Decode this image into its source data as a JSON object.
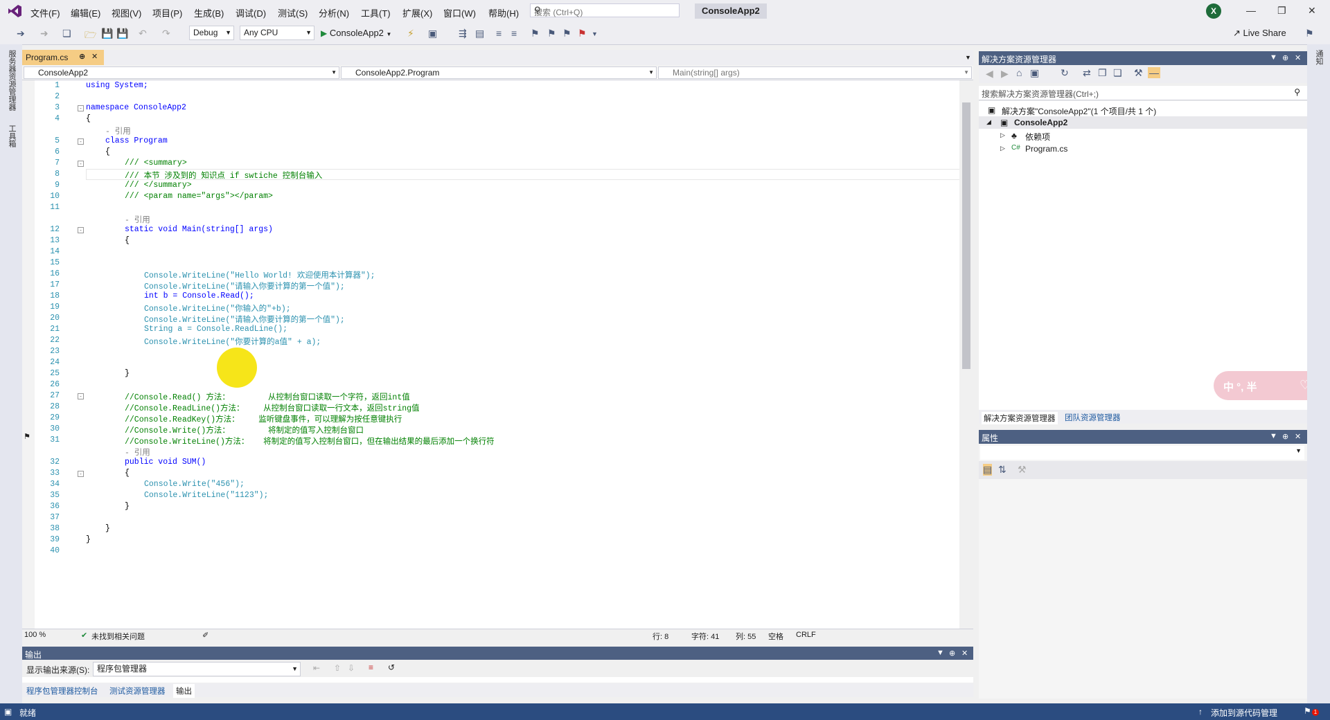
{
  "menubar": {
    "items": [
      "文件(F)",
      "编辑(E)",
      "视图(V)",
      "项目(P)",
      "生成(B)",
      "调试(D)",
      "测试(S)",
      "分析(N)",
      "工具(T)",
      "扩展(X)",
      "窗口(W)",
      "帮助(H)"
    ],
    "search_placeholder": "搜索 (Ctrl+Q)",
    "app_title": "ConsoleApp2",
    "profile_initial": "X"
  },
  "toolbar": {
    "config": "Debug",
    "platform": "Any CPU",
    "run_target": "ConsoleApp2",
    "live_share": "Live Share"
  },
  "left_strip": {
    "server_explorer": "服务器资源管理器",
    "toolbox": "工具箱"
  },
  "right_strip": {
    "notifications": "通知"
  },
  "editor": {
    "tab_label": "Program.cs",
    "nav_project": "ConsoleApp2",
    "nav_class": "ConsoleApp2.Program",
    "nav_member": "Main(string[] args)",
    "zoom": "100 %",
    "issues": "未找到相关问题",
    "line": "行: 8",
    "char": "字符: 41",
    "col": "列: 55",
    "whitespace": "空格",
    "eol": "CRLF",
    "lines": [
      {
        "n": "1",
        "t": "using System;"
      },
      {
        "n": "2",
        "t": ""
      },
      {
        "n": "3",
        "t": "namespace ConsoleApp2"
      },
      {
        "n": "4",
        "t": "{"
      },
      {
        "n": "",
        "t": "- 引用"
      },
      {
        "n": "5",
        "t": "class Program"
      },
      {
        "n": "6",
        "t": "{"
      },
      {
        "n": "7",
        "t": "/// <summary>"
      },
      {
        "n": "8",
        "t": "/// 本节 涉及到的 知识点 if swtiche 控制台输入"
      },
      {
        "n": "9",
        "t": "/// </summary>"
      },
      {
        "n": "10",
        "t": "/// <param name=\"args\"></param>"
      },
      {
        "n": "11",
        "t": ""
      },
      {
        "n": "",
        "t": "- 引用"
      },
      {
        "n": "12",
        "t": "static void Main(string[] args)"
      },
      {
        "n": "13",
        "t": "{"
      },
      {
        "n": "14",
        "t": ""
      },
      {
        "n": "15",
        "t": ""
      },
      {
        "n": "16",
        "t": "Console.WriteLine(\"Hello World! 欢迎使用本计算器\");"
      },
      {
        "n": "17",
        "t": "Console.WriteLine(\"请输入你要计算的第一个值\");"
      },
      {
        "n": "18",
        "t": "int b = Console.Read();"
      },
      {
        "n": "19",
        "t": "Console.WriteLine(\"你输入的\"+b);"
      },
      {
        "n": "20",
        "t": "Console.WriteLine(\"请输入你要计算的第一个值\");"
      },
      {
        "n": "21",
        "t": "String a = Console.ReadLine();"
      },
      {
        "n": "22",
        "t": "Console.WriteLine(\"你要计算的a值\" + a);"
      },
      {
        "n": "23",
        "t": ""
      },
      {
        "n": "24",
        "t": ""
      },
      {
        "n": "25",
        "t": "}"
      },
      {
        "n": "26",
        "t": ""
      },
      {
        "n": "27",
        "t": "//Console.Read() 方法：        从控制台窗口读取一个字符，返回int值"
      },
      {
        "n": "28",
        "t": "//Console.ReadLine()方法：    从控制台窗口读取一行文本，返回string值"
      },
      {
        "n": "29",
        "t": "//Console.ReadKey()方法：    监听键盘事件，可以理解为按任意键执行"
      },
      {
        "n": "30",
        "t": "//Console.Write()方法：        将制定的值写入控制台窗口"
      },
      {
        "n": "31",
        "t": "//Console.WriteLine()方法：   将制定的值写入控制台窗口，但在输出结果的最后添加一个换行符"
      },
      {
        "n": "",
        "t": "- 引用"
      },
      {
        "n": "32",
        "t": "public void SUM()"
      },
      {
        "n": "33",
        "t": "{"
      },
      {
        "n": "34",
        "t": "Console.Write(\"456\");"
      },
      {
        "n": "35",
        "t": "Console.WriteLine(\"1123\");"
      },
      {
        "n": "36",
        "t": "}"
      },
      {
        "n": "37",
        "t": ""
      },
      {
        "n": "38",
        "t": "}"
      },
      {
        "n": "39",
        "t": "}"
      },
      {
        "n": "40",
        "t": ""
      }
    ]
  },
  "output": {
    "title": "输出",
    "source_label": "显示输出来源(S):",
    "source_value": "程序包管理器",
    "tabs": [
      "程序包管理器控制台",
      "测试资源管理器",
      "输出"
    ]
  },
  "solution_explorer": {
    "title": "解决方案资源管理器",
    "search_placeholder": "搜索解决方案资源管理器(Ctrl+;)",
    "solution": "解决方案\"ConsoleApp2\"(1 个项目/共 1 个)",
    "project": "ConsoleApp2",
    "dependencies": "依赖项",
    "file": "Program.cs",
    "tabs": [
      "解决方案资源管理器",
      "团队资源管理器"
    ]
  },
  "properties": {
    "title": "属性"
  },
  "ime": {
    "text": "中 °, 半"
  },
  "statusbar": {
    "ready": "就绪",
    "source_control": "添加到源代码管理",
    "notif_count": "1"
  }
}
